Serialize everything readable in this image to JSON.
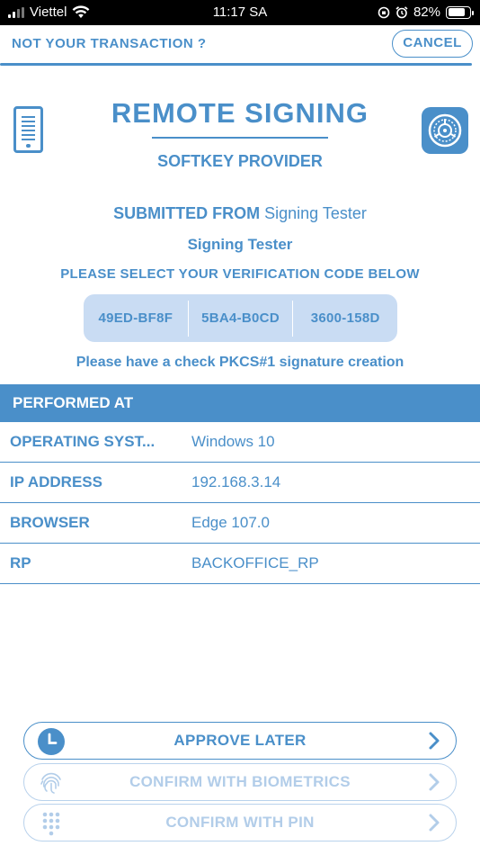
{
  "status_bar": {
    "carrier": "Viettel",
    "time": "11:17 SA",
    "battery": "82%",
    "battery_level": 0.82
  },
  "topbar": {
    "not_your_transaction": "NOT YOUR TRANSACTION ?",
    "cancel_label": "CANCEL"
  },
  "header": {
    "title": "REMOTE SIGNING",
    "subtitle": "SOFTKEY PROVIDER",
    "left_icon": "phone-document-icon",
    "right_icon": "settings-icon"
  },
  "request": {
    "submitted_from_label": "SUBMITTED FROM",
    "submitted_from_value": "Signing Tester",
    "signer": "Signing Tester",
    "select_code_prompt": "PLEASE SELECT YOUR VERIFICATION CODE BELOW",
    "codes": [
      "49ED-BF8F",
      "5BA4-B0CD",
      "3600-158D"
    ],
    "check_message": "Please have a check PKCS#1 signature creation"
  },
  "performed_at": {
    "heading": "PERFORMED AT",
    "rows": [
      {
        "label": "OPERATING SYST...",
        "value": "Windows 10"
      },
      {
        "label": "IP ADDRESS",
        "value": "192.168.3.14"
      },
      {
        "label": "BROWSER",
        "value": "Edge 107.0"
      },
      {
        "label": "RP",
        "value": "BACKOFFICE_RP"
      }
    ]
  },
  "actions": {
    "approve_later": "APPROVE LATER",
    "confirm_biometrics": "CONFIRM WITH BIOMETRICS",
    "confirm_pin": "CONFIRM WITH PIN"
  },
  "colors": {
    "accent": "#4a8fc9",
    "code_background": "#c9dcf3",
    "disabled": "#b2cde9"
  }
}
